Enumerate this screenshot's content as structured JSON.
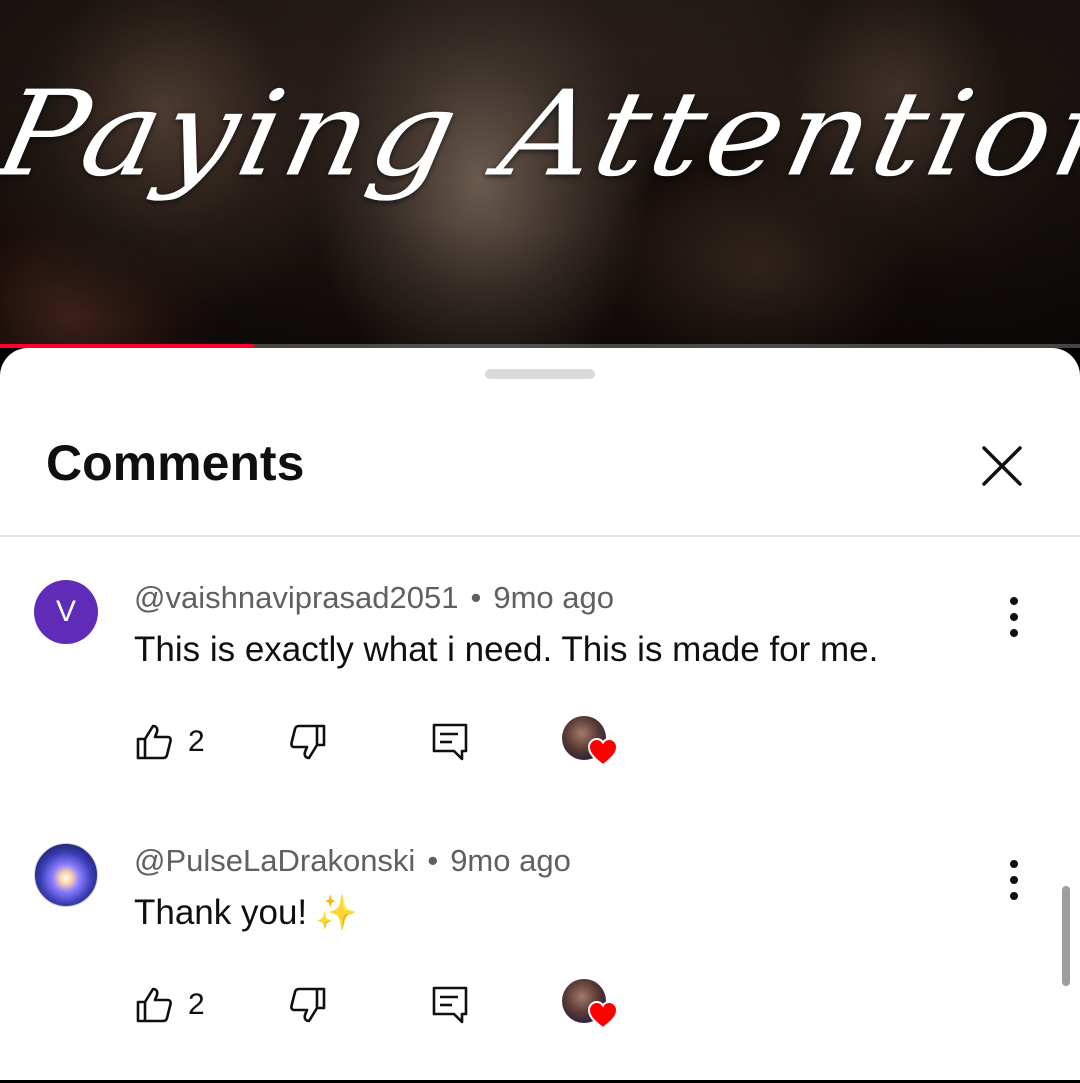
{
  "video": {
    "title_text": "Paying Attention",
    "progress_fraction": 0.235
  },
  "sheet": {
    "title": "Comments"
  },
  "comments": [
    {
      "avatar_letter": "V",
      "author": "@vaishnaviprasad2051",
      "separator": "•",
      "time": "9mo ago",
      "text": "This is exactly what i need. This is made for me.",
      "likes": "2"
    },
    {
      "avatar_letter": "",
      "author": "@PulseLaDrakonski",
      "separator": "•",
      "time": "9mo ago",
      "text": "Thank you!",
      "emoji": "✨",
      "likes": "2"
    }
  ],
  "colors": {
    "accent_red": "#ff0033",
    "avatar_purple": "#5f2bb8",
    "heart_red": "#ff0000"
  },
  "icons": [
    "close-icon",
    "kebab-menu-icon",
    "thumbs-up-icon",
    "thumbs-down-icon",
    "reply-icon",
    "creator-heart-icon"
  ]
}
